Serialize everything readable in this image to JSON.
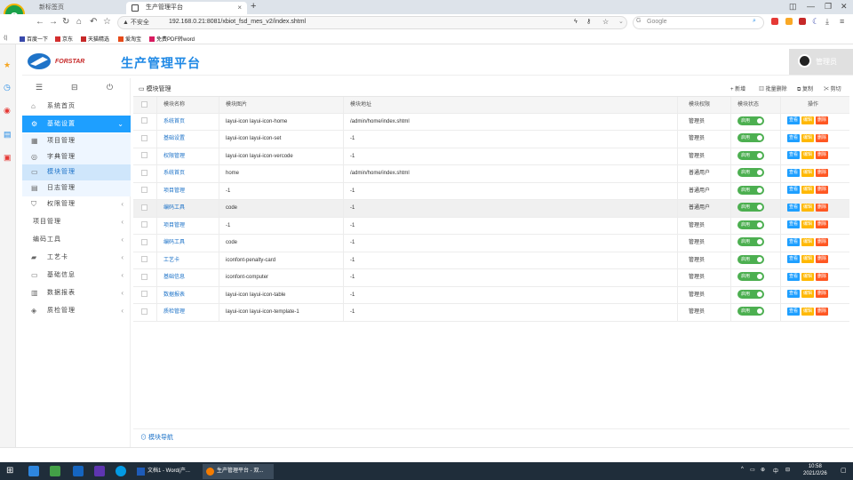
{
  "browser": {
    "tabs": [
      {
        "label": "新标签页"
      },
      {
        "label": "生产管理平台"
      }
    ],
    "security_warning": "▲ 不安全",
    "url": "192.168.0.21:8081/xbiot_fsd_mes_v2/index.shtml",
    "search_placeholder": "Google",
    "bookmarks": [
      "百度一下",
      "京东",
      "天猫精选",
      "爱淘宝",
      "免费PDF转word"
    ]
  },
  "app": {
    "brand": "FORSTAR",
    "title": "生产管理平台",
    "user": "管理员"
  },
  "sidebar": {
    "items": [
      {
        "icon": "home-icon",
        "label": "系统首页",
        "state": "normal"
      },
      {
        "icon": "gear-icon",
        "label": "基础设置",
        "state": "active",
        "arrow": "⌄"
      },
      {
        "icon": "grid-icon",
        "label": "项目管理",
        "state": "sub"
      },
      {
        "icon": "book-icon",
        "label": "字典管理",
        "state": "sub"
      },
      {
        "icon": "folder-icon",
        "label": "模块管理",
        "state": "sub-current"
      },
      {
        "icon": "list-icon",
        "label": "日志管理",
        "state": "sub"
      },
      {
        "icon": "shield-icon",
        "label": "权限管理",
        "state": "normal",
        "arrow": "‹"
      },
      {
        "icon": "",
        "label": "项目管理",
        "state": "normal",
        "arrow": "‹"
      },
      {
        "icon": "",
        "label": "编码工具",
        "state": "normal",
        "arrow": "‹"
      },
      {
        "icon": "card-icon",
        "label": "工艺卡",
        "state": "normal",
        "arrow": "‹"
      },
      {
        "icon": "monitor-icon",
        "label": "基础信息",
        "state": "normal",
        "arrow": "‹"
      },
      {
        "icon": "table-icon",
        "label": "数据报表",
        "state": "normal",
        "arrow": "‹"
      },
      {
        "icon": "stack-icon",
        "label": "质检管理",
        "state": "normal",
        "arrow": "‹"
      }
    ]
  },
  "main": {
    "breadcrumb": "模块管理",
    "toolbar": {
      "add": "+ 新增",
      "batch_delete": "批量删除",
      "copy": "复制",
      "cut": "剪切"
    },
    "columns": [
      "模块名称",
      "模块图片",
      "模块地址",
      "模块权限",
      "模块状态",
      "操作"
    ],
    "status_label": "启用",
    "actions": [
      "查看",
      "编辑",
      "删除"
    ],
    "rows": [
      {
        "name": "系统首页",
        "icon": "layui-icon layui-icon-home",
        "url": "/admin/home/index.shtml",
        "perm": "管理员"
      },
      {
        "name": "基础设置",
        "icon": "layui-icon layui-icon-set",
        "url": "-1",
        "perm": "管理员"
      },
      {
        "name": "权限管理",
        "icon": "layui-icon layui-icon-vercode",
        "url": "-1",
        "perm": "管理员"
      },
      {
        "name": "系统首页",
        "icon": "home",
        "url": "/admin/home/index.shtml",
        "perm": "普通用户"
      },
      {
        "name": "项目管理",
        "icon": "-1",
        "url": "-1",
        "perm": "普通用户"
      },
      {
        "name": "编码工具",
        "icon": "code",
        "url": "-1",
        "perm": "普通用户"
      },
      {
        "name": "项目管理",
        "icon": "-1",
        "url": "-1",
        "perm": "管理员"
      },
      {
        "name": "编码工具",
        "icon": "code",
        "url": "-1",
        "perm": "管理员"
      },
      {
        "name": "工艺卡",
        "icon": "iconfont-penalty-card",
        "url": "-1",
        "perm": "管理员"
      },
      {
        "name": "基础信息",
        "icon": "iconfont-computer",
        "url": "-1",
        "perm": "管理员"
      },
      {
        "name": "数据报表",
        "icon": "layui-icon layui-icon-table",
        "url": "-1",
        "perm": "管理员"
      },
      {
        "name": "质检管理",
        "icon": "layui-icon layui-icon-template-1",
        "url": "-1",
        "perm": "管理员"
      }
    ],
    "highlight_row": 5,
    "footer": "模块导航"
  },
  "taskbar": {
    "windows": [
      "文档1 - Word(产...",
      "生产管理平台 - 双..."
    ],
    "time": "10:58",
    "date": "2021/2/26",
    "ime": "中"
  },
  "colors": {
    "accent": "#1e9fff",
    "status_green": "#4caf50",
    "edit": "#ffb800",
    "delete": "#ff5722"
  }
}
